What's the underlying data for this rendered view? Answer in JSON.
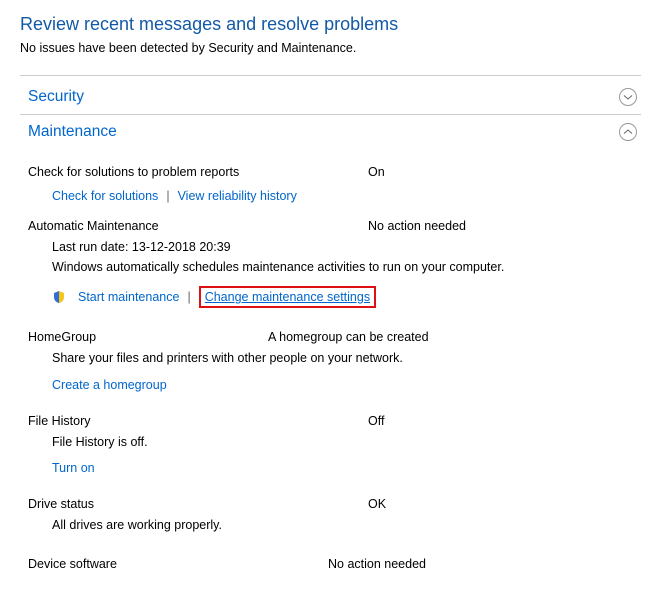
{
  "header": {
    "title": "Review recent messages and resolve problems",
    "subtitle": "No issues have been detected by Security and Maintenance."
  },
  "security": {
    "label": "Security"
  },
  "maintenance": {
    "label": "Maintenance",
    "solutions": {
      "label": "Check for solutions to problem reports",
      "status": "On",
      "link_check": "Check for solutions",
      "link_reliability": "View reliability history"
    },
    "auto": {
      "label": "Automatic Maintenance",
      "status": "No action needed",
      "last_run": "Last run date: 13-12-2018 20:39",
      "desc": "Windows automatically schedules maintenance activities to run on your computer.",
      "link_start": "Start maintenance",
      "link_change": "Change maintenance settings"
    },
    "homegroup": {
      "label": "HomeGroup",
      "status": "A homegroup can be created",
      "desc": "Share your files and printers with other people on your network.",
      "link_create": "Create a homegroup"
    },
    "filehistory": {
      "label": "File History",
      "status": "Off",
      "desc": "File History is off.",
      "link_on": "Turn on"
    },
    "drive": {
      "label": "Drive status",
      "status": "OK",
      "desc": "All drives are working properly."
    },
    "device": {
      "label": "Device software",
      "status": "No action needed"
    }
  }
}
